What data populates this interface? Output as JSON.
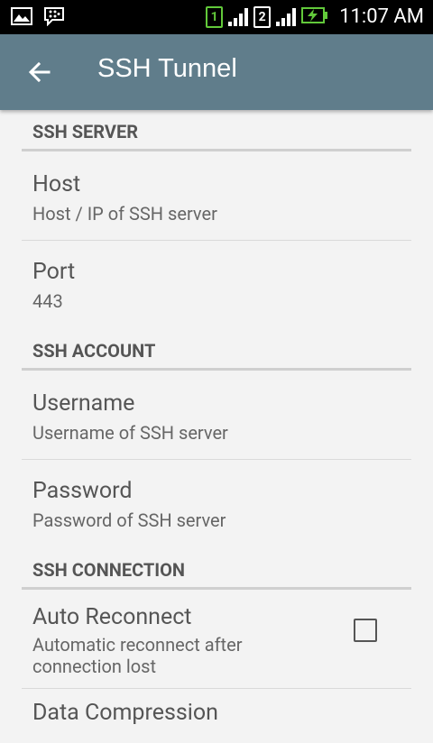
{
  "status_bar": {
    "time": "11:07 AM",
    "sim1": "1",
    "sim2": "2",
    "icons": [
      "image-icon",
      "bbm-chat-icon",
      "signal-icon",
      "battery-charging-icon"
    ]
  },
  "app_bar": {
    "title": "SSH Tunnel",
    "color": "#607d8b"
  },
  "sections": {
    "server": {
      "header": "SSH SERVER",
      "host": {
        "title": "Host",
        "summary": "Host / IP of SSH server"
      },
      "port": {
        "title": "Port",
        "summary": "443"
      }
    },
    "account": {
      "header": "SSH ACCOUNT",
      "username": {
        "title": "Username",
        "summary": "Username of SSH server"
      },
      "password": {
        "title": "Password",
        "summary": "Password of SSH server"
      }
    },
    "connection": {
      "header": "SSH CONNECTION",
      "auto_reconnect": {
        "title": "Auto Reconnect",
        "summary": "Automatic reconnect after connection lost",
        "checked": false
      },
      "data_compression": {
        "title": "Data Compression"
      }
    }
  }
}
